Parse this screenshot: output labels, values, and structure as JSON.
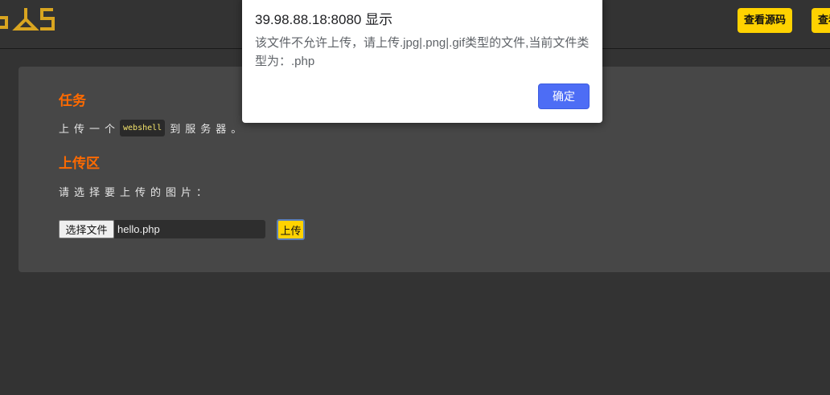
{
  "header": {
    "logo_icon": "logo-icon",
    "view_source_label": "查看源码",
    "second_button_label": "查看提示"
  },
  "task": {
    "heading": "任务",
    "text_before": "上传一个",
    "code": "webshell",
    "text_after": "到服务器。"
  },
  "upload": {
    "heading": "上传区",
    "prompt": "请选择要上传的图片：",
    "choose_file_label": "选择文件",
    "file_name": "hello.php",
    "submit_label": "上传"
  },
  "dialog": {
    "title": "39.98.88.18:8080 显示",
    "message": "该文件不允许上传，请上传.jpg|.png|.gif类型的文件,当前文件类型为：.php",
    "ok_label": "确定"
  },
  "colors": {
    "accent_yellow": "#ffd200",
    "heading_orange": "#ff6a00",
    "dialog_button_blue": "#4d6df5"
  }
}
